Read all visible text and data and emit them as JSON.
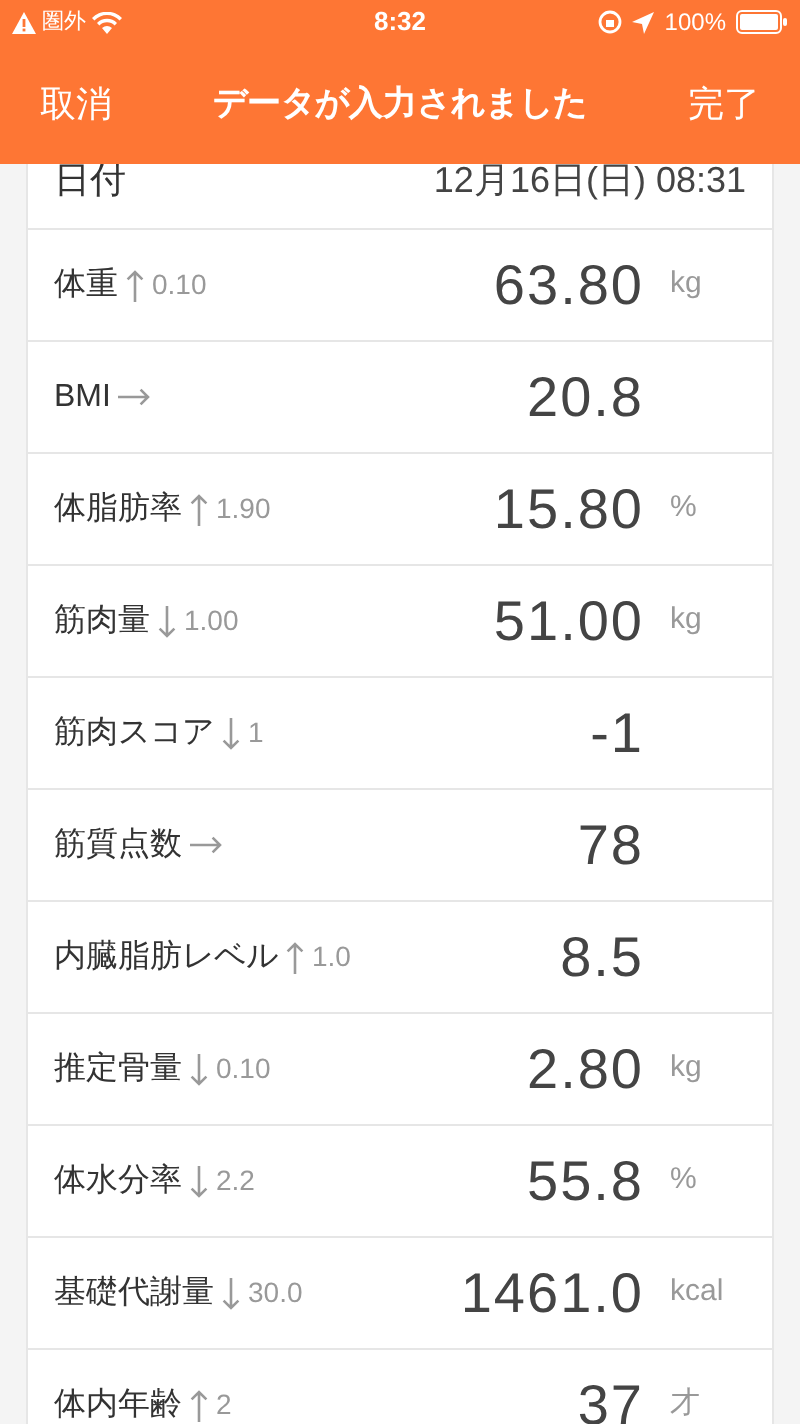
{
  "status_bar": {
    "carrier": "圏外",
    "time": "8:32",
    "battery": "100%"
  },
  "nav_bar": {
    "cancel": "取消",
    "title": "データが入力されました",
    "done": "完了"
  },
  "date_row": {
    "label": "日付",
    "value": "12月16日(日) 08:31"
  },
  "measurements": [
    {
      "label": "体重",
      "kind": "up",
      "change": "0.10",
      "value": "63.80",
      "unit": "kg"
    },
    {
      "label": "BMI",
      "kind": "flat",
      "value": "20.8"
    },
    {
      "label": "体脂肪率",
      "kind": "up",
      "change": "1.90",
      "value": "15.80",
      "unit": "%"
    },
    {
      "label": "筋肉量",
      "kind": "down",
      "change": "1.00",
      "value": "51.00",
      "unit": "kg"
    },
    {
      "label": "筋肉スコア",
      "kind": "down",
      "change": "1",
      "value": "-1"
    },
    {
      "label": "筋質点数",
      "kind": "flat",
      "value": "78"
    },
    {
      "label": "内臓脂肪レベル",
      "kind": "up",
      "change": "1.0",
      "value": "8.5"
    },
    {
      "label": "推定骨量",
      "kind": "down",
      "change": "0.10",
      "value": "2.80",
      "unit": "kg"
    },
    {
      "label": "体水分率",
      "kind": "down",
      "change": "2.2",
      "value": "55.8",
      "unit": "%"
    },
    {
      "label": "基礎代謝量",
      "kind": "down",
      "change": "30.0",
      "value": "1461.0",
      "unit": "kcal"
    },
    {
      "label": "体内年齢",
      "kind": "up",
      "change": "2",
      "value": "37",
      "unit": "才"
    }
  ]
}
